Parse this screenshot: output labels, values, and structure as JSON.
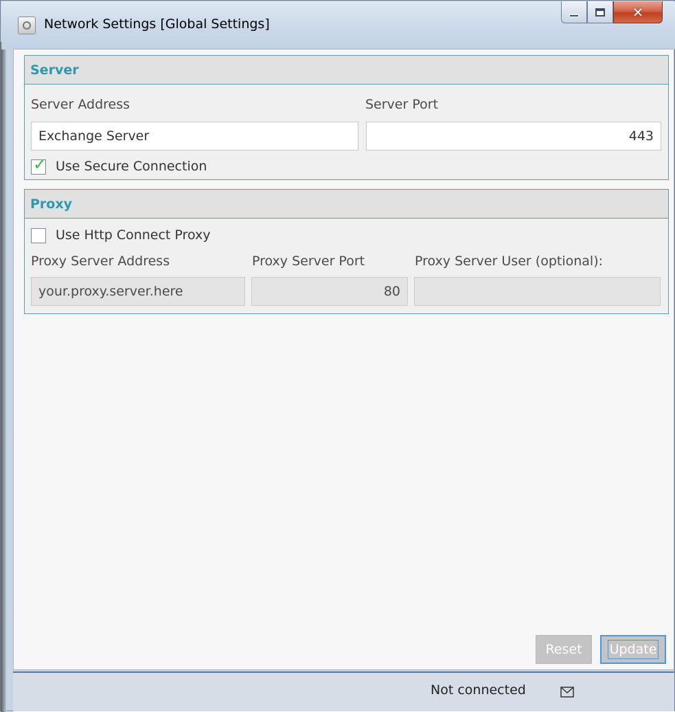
{
  "window": {
    "title": "Network Settings [Global Settings]",
    "min_icon": "minimize-icon",
    "max_icon": "maximize-icon",
    "close_icon": "close-icon",
    "close_glyph": "✕"
  },
  "server": {
    "header": "Server",
    "address_label": "Server Address",
    "address_value": "Exchange Server",
    "port_label": "Server Port",
    "port_value": "443",
    "secure_label": "Use Secure Connection",
    "secure_checked": true
  },
  "proxy": {
    "header": "Proxy",
    "use_label": "Use Http Connect Proxy",
    "use_checked": false,
    "address_label": "Proxy Server Address",
    "address_value": "your.proxy.server.here",
    "port_label": "Proxy Server Port",
    "port_value": "80",
    "user_label": "Proxy Server User (optional):",
    "user_value": ""
  },
  "buttons": {
    "reset": "Reset",
    "update": "Update"
  },
  "status": {
    "text": "Not connected",
    "icon": "mail-icon"
  },
  "colors": {
    "header_text": "#2a9aae",
    "panel_border": "#5e9ea8",
    "check": "#28c23c",
    "focus": "#3f9ae8"
  }
}
